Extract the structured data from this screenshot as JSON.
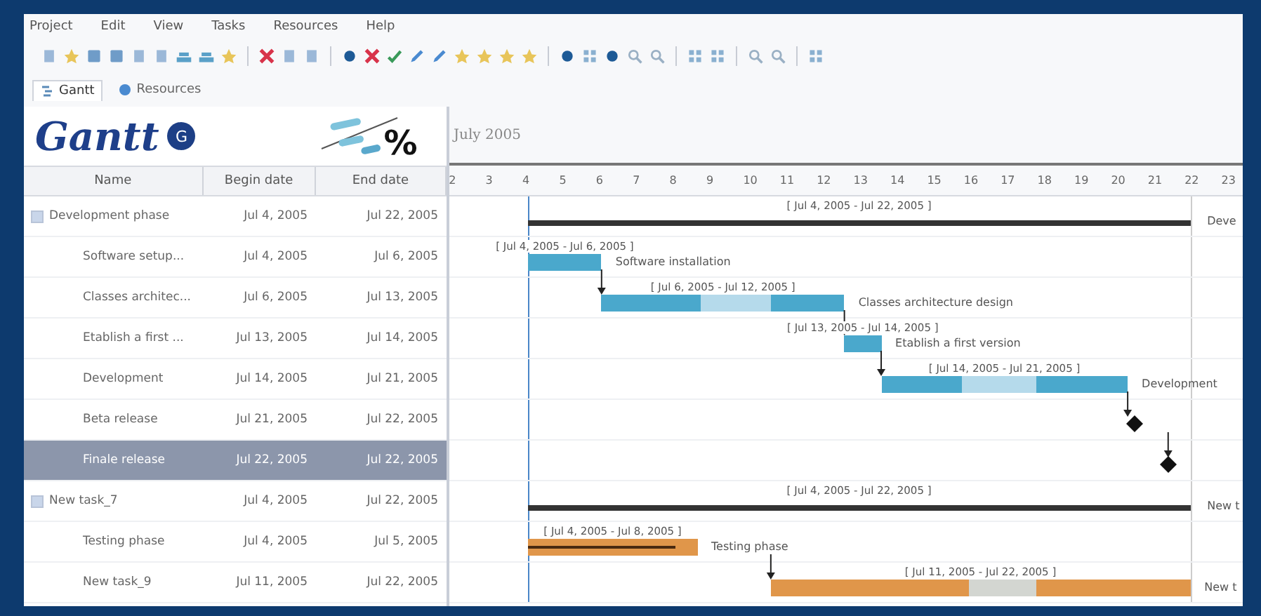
{
  "menu": [
    "Project",
    "Edit",
    "View",
    "Tasks",
    "Resources",
    "Help"
  ],
  "tabs": [
    {
      "label": "Gantt",
      "selected": true
    },
    {
      "label": "Resources",
      "selected": false
    }
  ],
  "logo": {
    "title": "Gantt",
    "badge": "G",
    "mark": "%"
  },
  "table": {
    "columns": [
      "Name",
      "Begin date",
      "End date"
    ],
    "rows": [
      {
        "name": "Development phase",
        "begin": "Jul 4, 2005",
        "end": "Jul 22, 2005",
        "expanded": true,
        "selected": false,
        "children": [
          {
            "name": "Software setup...",
            "begin": "Jul 4, 2005",
            "end": "Jul 6, 2005",
            "selected": false
          },
          {
            "name": "Classes architec...",
            "begin": "Jul 6, 2005",
            "end": "Jul 13, 2005",
            "selected": false
          },
          {
            "name": "Etablish a first ...",
            "begin": "Jul 13, 2005",
            "end": "Jul 14, 2005",
            "selected": false
          },
          {
            "name": "Development",
            "begin": "Jul 14, 2005",
            "end": "Jul 21, 2005",
            "selected": false
          },
          {
            "name": "Beta release",
            "begin": "Jul 21, 2005",
            "end": "Jul 22, 2005",
            "selected": false
          },
          {
            "name": "Finale release",
            "begin": "Jul 22, 2005",
            "end": "Jul 22, 2005",
            "selected": true
          }
        ]
      },
      {
        "name": "New task_7",
        "begin": "Jul 4, 2005",
        "end": "Jul 22, 2005",
        "expanded": true,
        "selected": false,
        "children": [
          {
            "name": "Testing phase",
            "begin": "Jul 4, 2005",
            "end": "Jul 5, 2005",
            "selected": false
          },
          {
            "name": "New task_9",
            "begin": "Jul 11, 2005",
            "end": "Jul 22, 2005",
            "selected": false
          }
        ]
      }
    ]
  },
  "chart": {
    "month": "July 2005",
    "days": [
      "2",
      "3",
      "4",
      "5",
      "6",
      "7",
      "8",
      "9",
      "10",
      "11",
      "12",
      "13",
      "14",
      "15",
      "16",
      "17",
      "18",
      "19",
      "20",
      "21",
      "22",
      "23"
    ],
    "bars": [
      {
        "kind": "summary",
        "range": "[ Jul 4, 2005 - Jul 22, 2005 ]",
        "label": "Deve"
      },
      {
        "kind": "task",
        "color": "#4aa8cc",
        "range": "[ Jul 4, 2005 - Jul 6, 2005 ]",
        "label": "Software installation"
      },
      {
        "kind": "task",
        "color": "#4aa8cc",
        "range": "[ Jul 6, 2005 - Jul 12, 2005 ]",
        "label": "Classes architecture design"
      },
      {
        "kind": "task",
        "color": "#4aa8cc",
        "range": "[ Jul 13, 2005 - Jul 14, 2005 ]",
        "label": "Etablish a first version"
      },
      {
        "kind": "task",
        "color": "#4aa8cc",
        "range": "[ Jul 14, 2005 - Jul 21, 2005 ]",
        "label": "Development"
      },
      {
        "kind": "milestone"
      },
      {
        "kind": "milestone"
      },
      {
        "kind": "summary",
        "range": "[ Jul 4, 2005 - Jul 22, 2005 ]",
        "label": "New t"
      },
      {
        "kind": "task",
        "color": "#e0964a",
        "range": "[ Jul 4, 2005 - Jul 8, 2005 ]",
        "label": "Testing phase"
      },
      {
        "kind": "task",
        "color": "#e0964a",
        "range": "[ Jul 11, 2005 - Jul 22, 2005 ]",
        "label": "New t"
      }
    ]
  }
}
